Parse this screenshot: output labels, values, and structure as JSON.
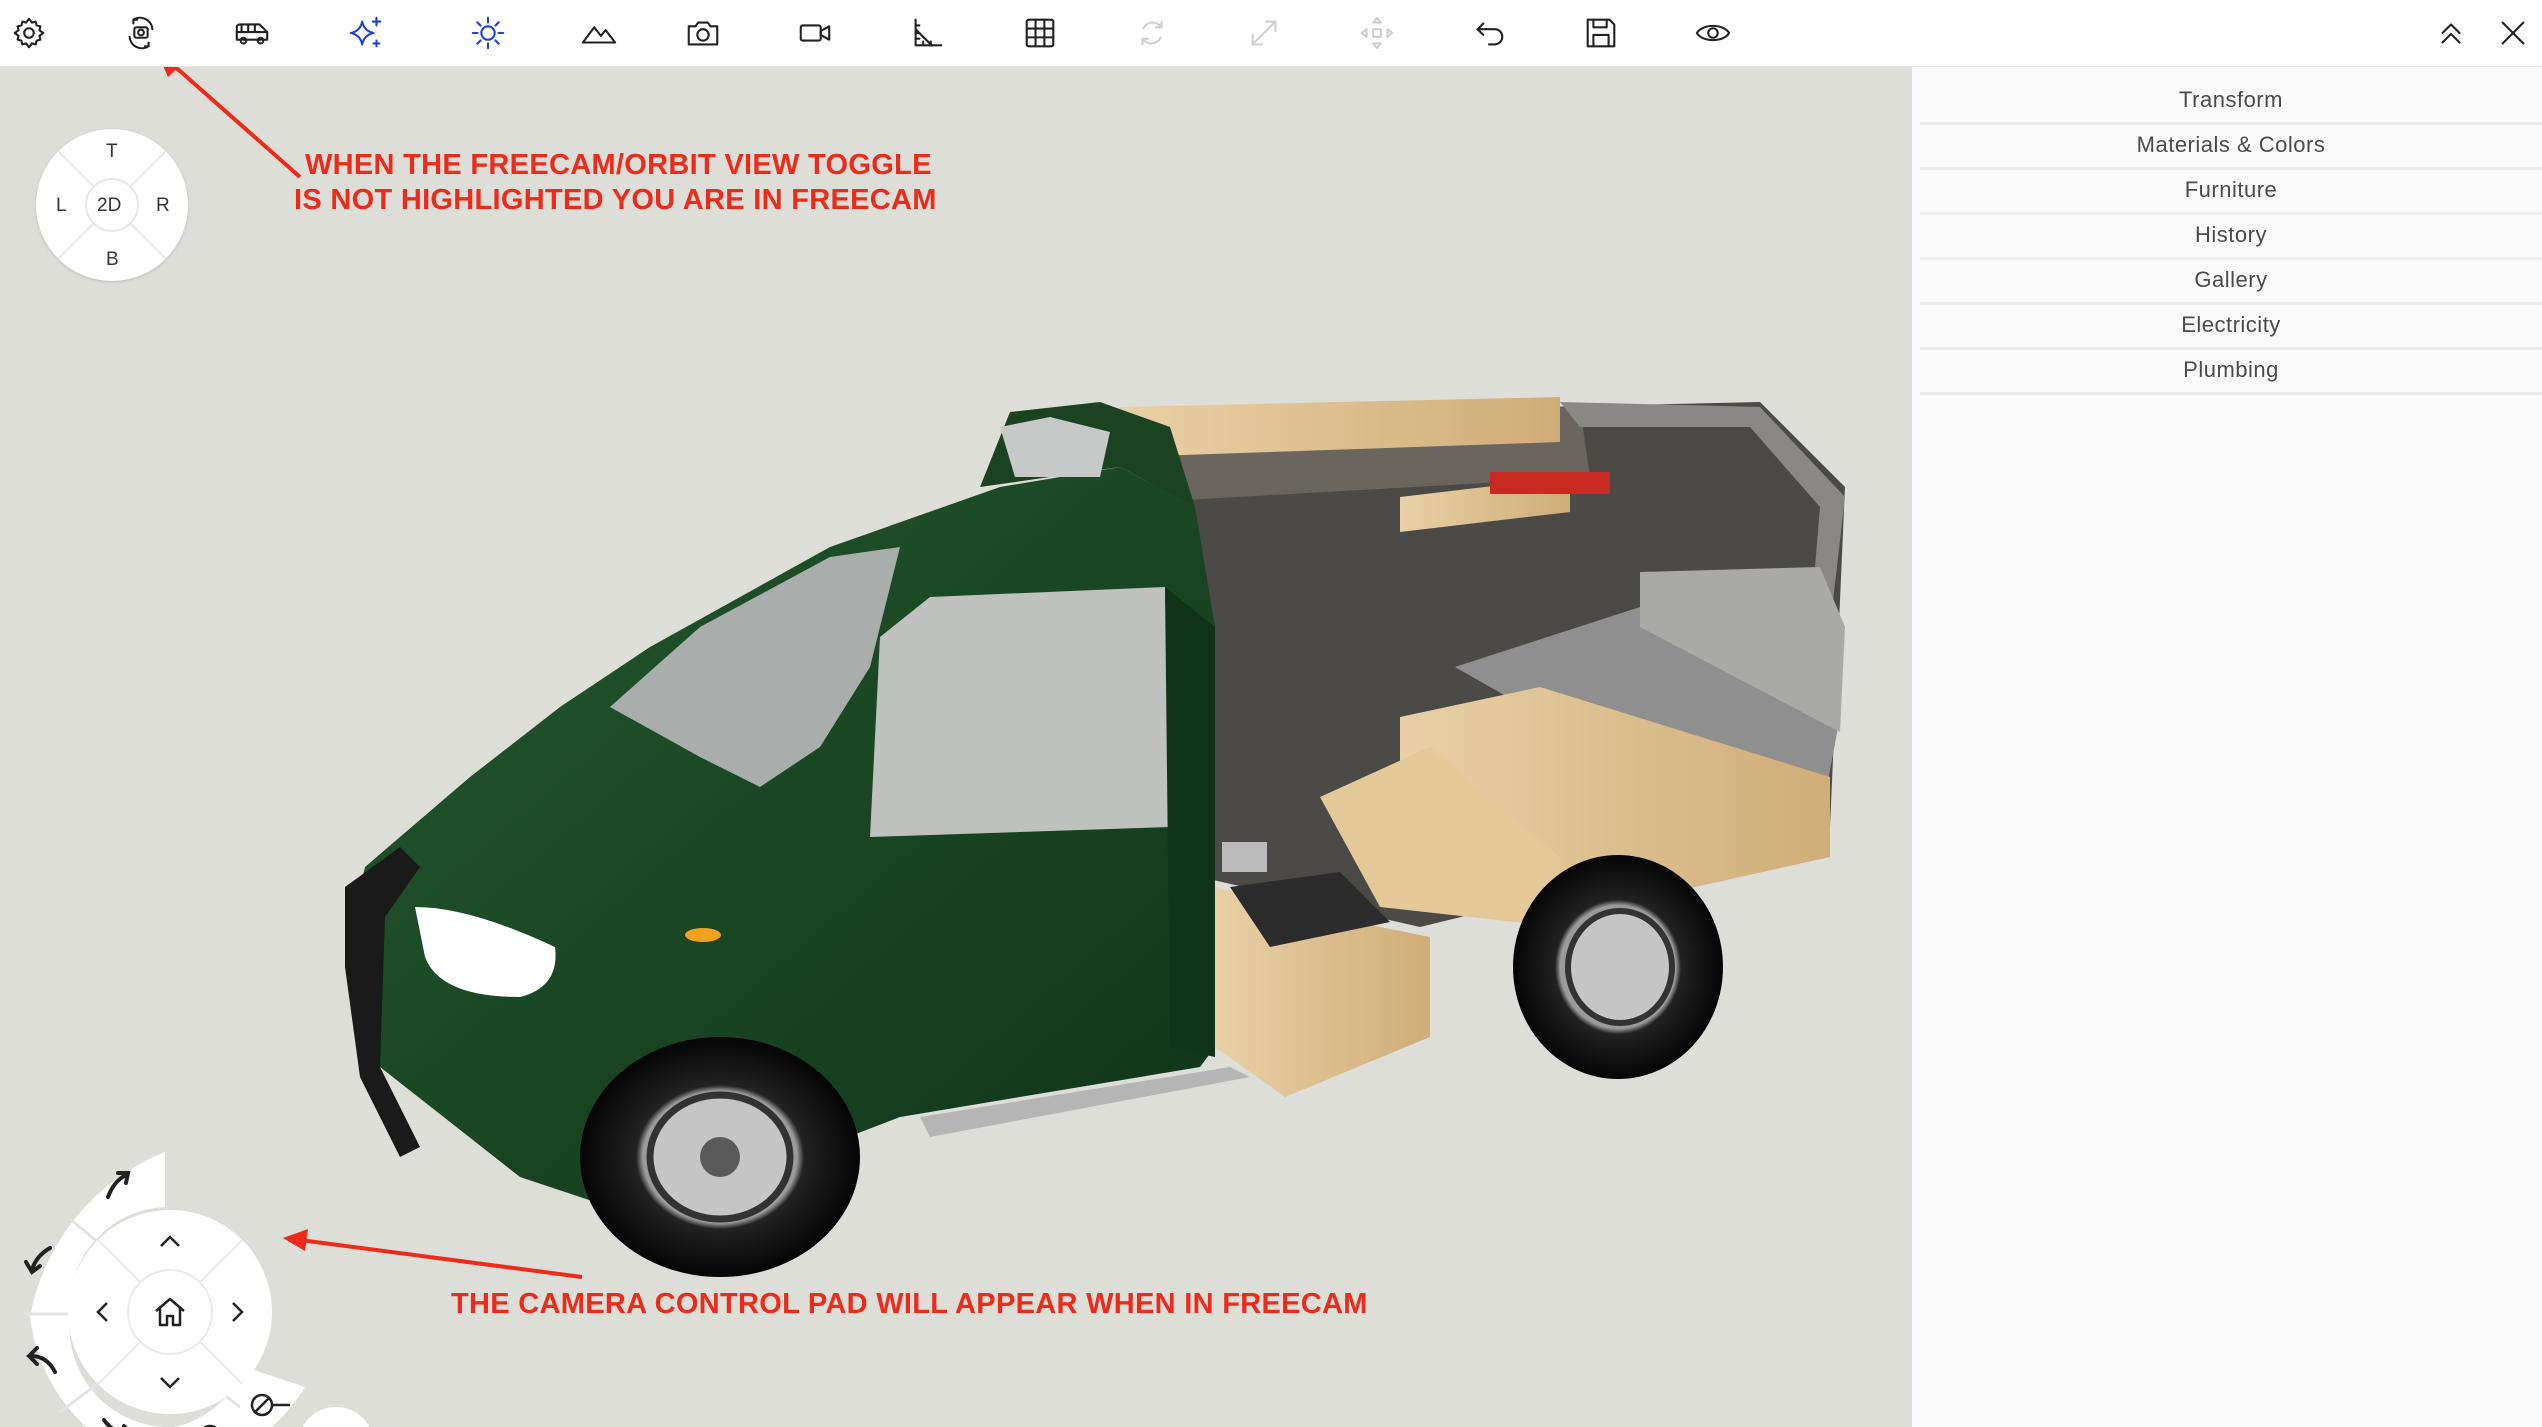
{
  "toolbar": {
    "left_icons": [
      {
        "name": "settings-icon",
        "state": "normal"
      },
      {
        "name": "freecam-orbit-toggle-icon",
        "state": "normal"
      },
      {
        "name": "van-icon",
        "state": "normal"
      },
      {
        "name": "sparkle-icon",
        "state": "active"
      },
      {
        "name": "sun-icon",
        "state": "active"
      },
      {
        "name": "terrain-icon",
        "state": "normal"
      },
      {
        "name": "camera-icon",
        "state": "normal"
      },
      {
        "name": "video-icon",
        "state": "normal"
      },
      {
        "name": "measure-icon",
        "state": "normal"
      },
      {
        "name": "grid-icon",
        "state": "normal"
      },
      {
        "name": "rotate-icon",
        "state": "disabled"
      },
      {
        "name": "scale-icon",
        "state": "disabled"
      },
      {
        "name": "move-icon",
        "state": "disabled"
      },
      {
        "name": "undo-icon",
        "state": "normal"
      },
      {
        "name": "save-icon",
        "state": "normal"
      },
      {
        "name": "eye-icon",
        "state": "normal"
      }
    ],
    "right_icons": [
      "collapse-up-icon",
      "close-icon"
    ]
  },
  "side_menu": {
    "items": [
      "Transform",
      "Materials & Colors",
      "Furniture",
      "History",
      "Gallery",
      "Electricity",
      "Plumbing"
    ]
  },
  "view_cube": {
    "top": "T",
    "bottom": "B",
    "left": "L",
    "right": "R",
    "center": "2D"
  },
  "annotations": {
    "top_line1": "WHEN THE FREECAM/ORBIT VIEW TOGGLE",
    "top_line2": "IS NOT HIGHLIGHTED YOU ARE IN FREECAM",
    "bottom": "THE CAMERA CONTROL PAD WILL APPEAR WHEN IN FREECAM"
  },
  "colors": {
    "annotation": "#ee2a1a",
    "active_icon": "#1f3fe0",
    "viewport_bg": "#deded9",
    "van_body": "#1c4a24",
    "wood": "#d8bb8c"
  }
}
